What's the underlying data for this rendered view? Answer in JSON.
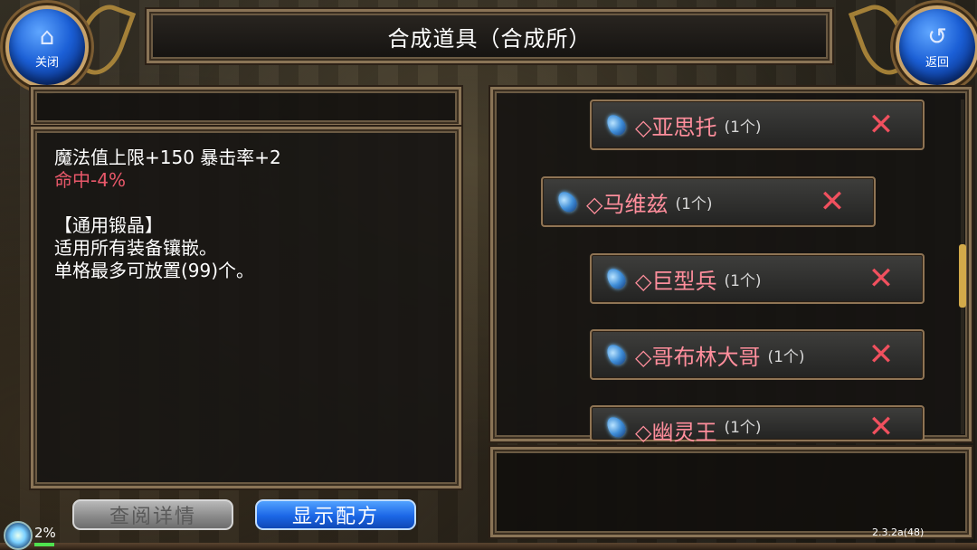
{
  "header": {
    "title": "合成道具（合成所）",
    "close_label": "关闭",
    "back_label": "返回"
  },
  "info": {
    "stats_line": "魔法值上限+150 暴击率+2",
    "penalty_line": "命中-4%",
    "category": "【通用锻晶】",
    "desc_line1": "适用所有装备镶嵌。",
    "desc_line2": "单格最多可放置(99)个。"
  },
  "buttons": {
    "details_label": "查阅详情",
    "recipe_label": "显示配方"
  },
  "list": {
    "items": [
      {
        "name": "◇亚思托",
        "count": "(1个)"
      },
      {
        "name": "◇马维兹",
        "count": "(1个)"
      },
      {
        "name": "◇巨型兵",
        "count": "(1个)"
      },
      {
        "name": "◇哥布林大哥",
        "count": "(1个)"
      },
      {
        "name": "◇幽灵王",
        "count": "(1个)"
      }
    ],
    "remove_glyph": "✕"
  },
  "status": {
    "percent": "2%",
    "version": "2.3.2a(48)"
  },
  "icons": {
    "home": "home-icon",
    "back": "return-arrow-icon",
    "gem": "blue-crystal-icon"
  },
  "colors": {
    "accent_blue": "#1b66e6",
    "item_name": "#ff8e9c",
    "penalty": "#e9586a",
    "remove": "#f0505e"
  }
}
